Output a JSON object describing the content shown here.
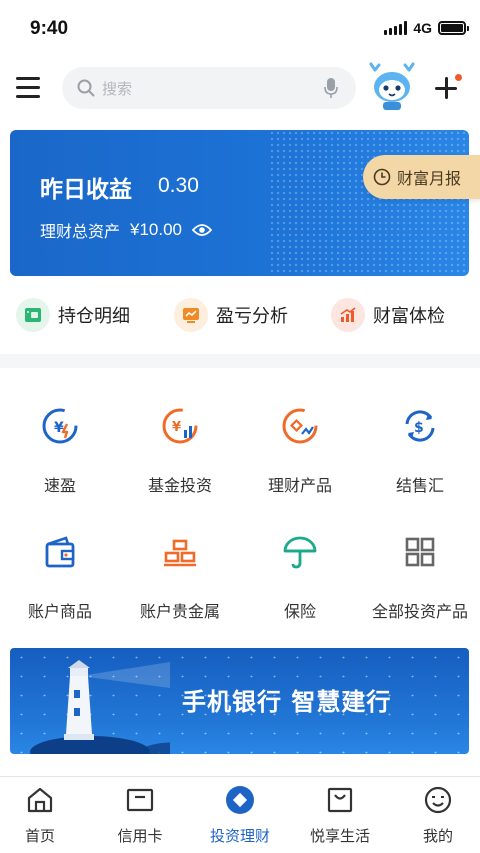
{
  "status_bar": {
    "time": "9:40",
    "network": "4G"
  },
  "search": {
    "placeholder": "搜索"
  },
  "card": {
    "title": "昨日收益",
    "yesterday_income": "0.30",
    "assets_label": "理财总资产",
    "assets_value": "¥10.00"
  },
  "report_button": "财富月报",
  "quick_actions": [
    {
      "label": "持仓明细",
      "icon": "holdings-icon",
      "color": "#2bb673"
    },
    {
      "label": "盈亏分析",
      "icon": "profit-chart-icon",
      "color": "#f08a24"
    },
    {
      "label": "财富体检",
      "icon": "wealth-check-icon",
      "color": "#f05a28"
    }
  ],
  "products": [
    {
      "label": "速盈",
      "icon": "quick-profit-icon",
      "color": "#1e64c8"
    },
    {
      "label": "基金投资",
      "icon": "fund-icon",
      "color": "#f06a28"
    },
    {
      "label": "理财产品",
      "icon": "wealth-product-icon",
      "color": "#f06a28"
    },
    {
      "label": "结售汇",
      "icon": "currency-exchange-icon",
      "color": "#1e64c8"
    },
    {
      "label": "账户商品",
      "icon": "wallet-icon",
      "color": "#1e64c8"
    },
    {
      "label": "账户贵金属",
      "icon": "gold-bars-icon",
      "color": "#f06a28"
    },
    {
      "label": "保险",
      "icon": "umbrella-icon",
      "color": "#1aaa8a"
    },
    {
      "label": "全部投资产品",
      "icon": "grid-icon",
      "color": "#666666"
    }
  ],
  "banner": {
    "slogan": "手机银行  智慧建行"
  },
  "tabs": [
    {
      "label": "首页",
      "icon": "home-icon",
      "active": false
    },
    {
      "label": "信用卡",
      "icon": "credit-card-icon",
      "active": false
    },
    {
      "label": "投资理财",
      "icon": "investment-icon",
      "active": true
    },
    {
      "label": "悦享生活",
      "icon": "shopping-bag-icon",
      "active": false
    },
    {
      "label": "我的",
      "icon": "profile-icon",
      "active": false
    }
  ],
  "colors": {
    "primary": "#1e64c8",
    "accent_orange": "#f06a28",
    "report_bg": "#f3d7a6"
  }
}
